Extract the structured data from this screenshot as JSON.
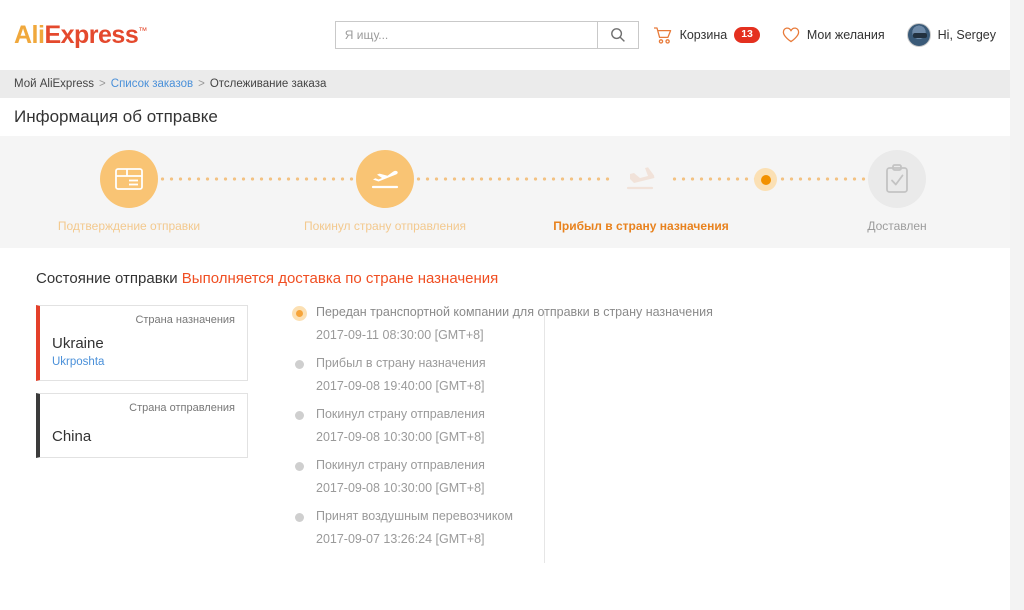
{
  "header": {
    "logo_ali": "Ali",
    "logo_express": "Express",
    "logo_tm": "™",
    "search_placeholder": "Я ищу...",
    "search_value": "",
    "cart_label": "Корзина",
    "cart_badge": "13",
    "wishlist_label": "Мои желания",
    "greeting": "Hi, Sergey"
  },
  "breadcrumb": {
    "root": "Мой AliExpress",
    "sep1": ">",
    "link": "Список заказов",
    "sep2": ">",
    "current": "Отслеживание заказа"
  },
  "page_title": "Информация об отправке",
  "stepper": {
    "steps": [
      {
        "label": "Подтверждение отправки",
        "icon": "package-icon",
        "state": "done"
      },
      {
        "label": "Покинул страну отправления",
        "icon": "plane-departure-icon",
        "state": "done"
      },
      {
        "label": "Прибыл в страну назначения",
        "icon": "plane-arrival-icon",
        "state": "current"
      },
      {
        "label": "Доставлен",
        "icon": "clipboard-check-icon",
        "state": "idle"
      }
    ]
  },
  "status": {
    "label": "Состояние отправки",
    "value": "Выполняется доставка по стране назначения"
  },
  "destination": {
    "caption": "Страна назначения",
    "country": "Ukraine",
    "carrier": "Ukrposhta"
  },
  "origin": {
    "caption": "Страна отправления",
    "country": "China"
  },
  "timeline": [
    {
      "text": "Передан транспортной компании для отправки в страну назначения",
      "date": "2017-09-11 08:30:00 [GMT+8]",
      "active": true
    },
    {
      "text": "Прибыл в страну назначения",
      "date": "2017-09-08 19:40:00 [GMT+8]",
      "active": false
    },
    {
      "text": "Покинул страну отправления",
      "date": "2017-09-08 10:30:00 [GMT+8]",
      "active": false
    },
    {
      "text": "Покинул страну отправления",
      "date": "2017-09-08 10:30:00 [GMT+8]",
      "active": false
    },
    {
      "text": "Принят воздушным перевозчиком",
      "date": "2017-09-07 13:26:24 [GMT+8]",
      "active": false
    }
  ],
  "colors": {
    "brand_orange": "#f0a83c",
    "brand_red": "#e4492d",
    "accent": "#e8821e",
    "link": "#4a90d9",
    "badge": "#e4301f"
  }
}
